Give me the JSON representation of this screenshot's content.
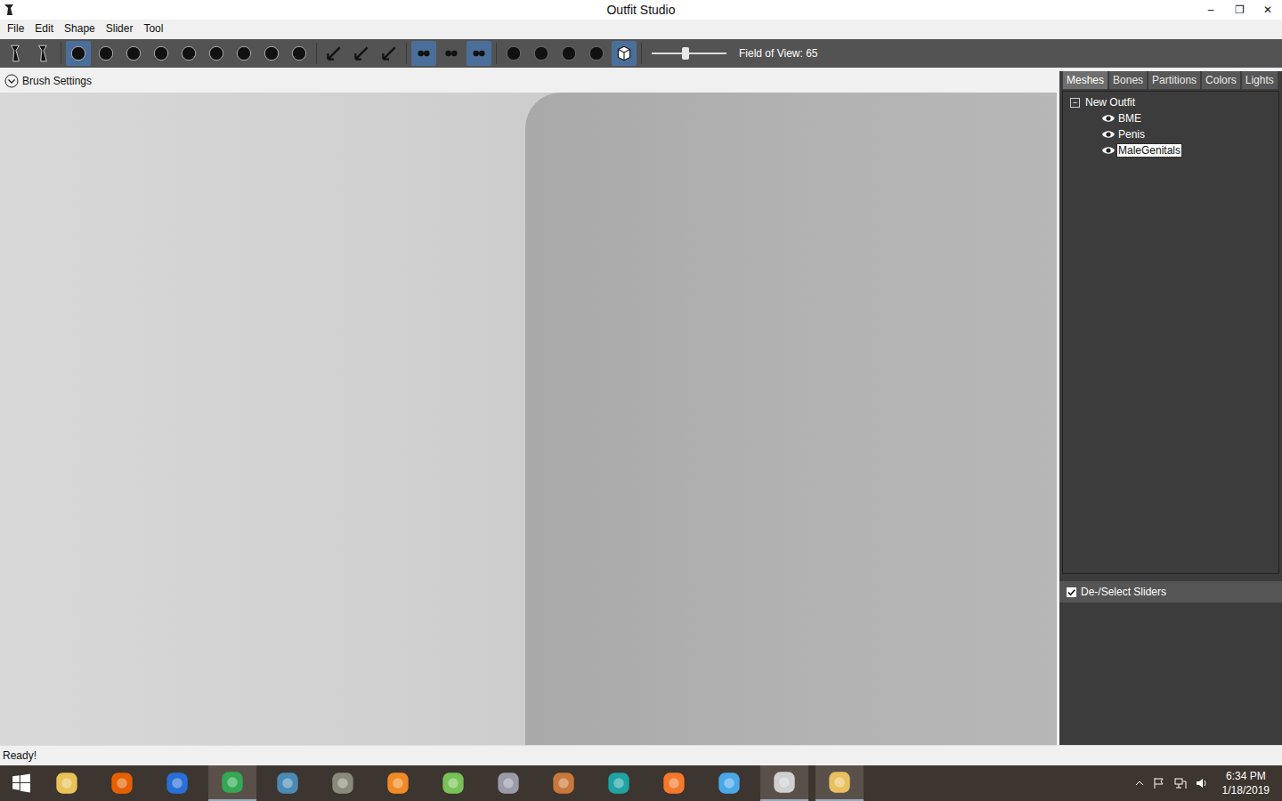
{
  "window": {
    "title": "Outfit Studio",
    "controls": [
      "–",
      "❐",
      "✕"
    ]
  },
  "menu": [
    "File",
    "Edit",
    "Shape",
    "Slider",
    "Tool"
  ],
  "toolbar": {
    "groups": [
      [
        {
          "selected": false
        },
        {
          "selected": false
        }
      ],
      [
        {
          "selected": true
        },
        {
          "selected": false
        },
        {
          "selected": false
        },
        {
          "selected": false
        },
        {
          "selected": false
        },
        {
          "selected": false
        },
        {
          "selected": false
        },
        {
          "selected": false
        },
        {
          "selected": false
        }
      ],
      [
        {
          "selected": false
        },
        {
          "selected": false
        },
        {
          "selected": false
        }
      ],
      [
        {
          "selected": true
        },
        {
          "selected": false
        },
        {
          "selected": true
        }
      ],
      [
        {
          "selected": false
        },
        {
          "selected": false
        },
        {
          "selected": false
        },
        {
          "selected": false
        },
        {
          "selected": true
        }
      ]
    ],
    "slider_level": 0.45,
    "field_of_view": "Field of View: 65"
  },
  "brush_settings": {
    "label": "Brush Settings",
    "expanded": false
  },
  "panel": {
    "tabs": [
      {
        "label": "Meshes",
        "selected": true
      },
      {
        "label": "Bones",
        "selected": false
      },
      {
        "label": "Partitions",
        "selected": false
      },
      {
        "label": "Colors",
        "selected": false
      },
      {
        "label": "Lights",
        "selected": false
      }
    ],
    "tree": {
      "label": "New Outfit",
      "expanded": true,
      "items": [
        {
          "label": "BME",
          "visible": true,
          "selected": false
        },
        {
          "label": "Penis",
          "visible": true,
          "selected": false
        },
        {
          "label": "MaleGenitals",
          "visible": true,
          "selected": true
        }
      ]
    },
    "sliders_toggle": {
      "label": "De-/Select Sliders",
      "checked": true
    }
  },
  "status_bar": "Ready!",
  "taskbar": {
    "apps": [
      {
        "color": "#e8c35a",
        "active": false
      },
      {
        "color": "#e66000",
        "active": false
      },
      {
        "color": "#2a6fd6",
        "active": false
      },
      {
        "color": "#34a853",
        "active": true
      },
      {
        "color": "#4a8ab5",
        "active": false
      },
      {
        "color": "#8a8a7a",
        "active": false
      },
      {
        "color": "#f08a24",
        "active": false
      },
      {
        "color": "#78c257",
        "active": false
      },
      {
        "color": "#9a9aa8",
        "active": false
      },
      {
        "color": "#c8783a",
        "active": false
      },
      {
        "color": "#1fa3a3",
        "active": false
      },
      {
        "color": "#f5792a",
        "active": false
      },
      {
        "color": "#4aa8e8",
        "active": false
      },
      {
        "color": "#d0d0d0",
        "active": true
      },
      {
        "color": "#e8c060",
        "active": true
      }
    ],
    "time": "6:34 PM",
    "date": "1/18/2019"
  }
}
